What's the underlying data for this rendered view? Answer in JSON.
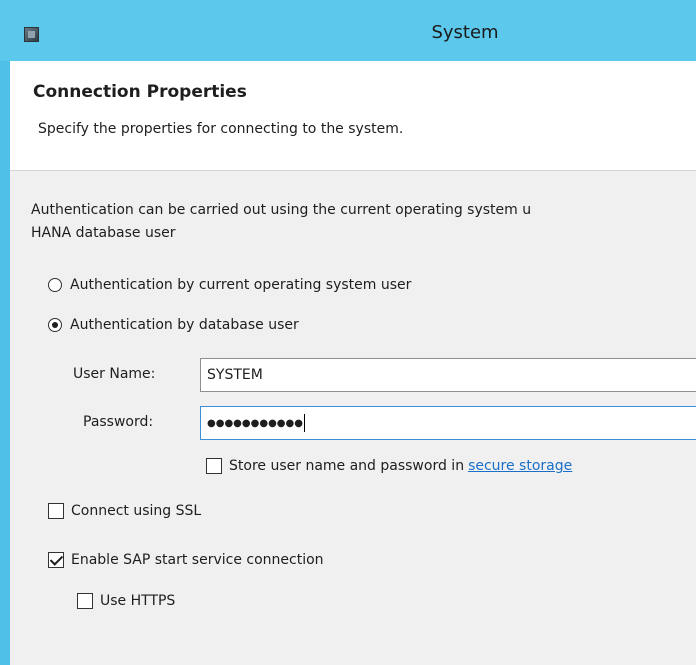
{
  "window": {
    "title": "System"
  },
  "header": {
    "title": "Connection Properties",
    "description": "Specify the properties for connecting to the system."
  },
  "intro_text": "Authentication can be carried out using the current operating system u\nHANA database user",
  "auth": {
    "os_user_label": "Authentication by current operating system user",
    "os_user_selected": false,
    "db_user_label": "Authentication by database user",
    "db_user_selected": true
  },
  "fields": {
    "user_name_label": "User Name:",
    "user_name_value": "SYSTEM",
    "password_label": "Password:",
    "password_value": "●●●●●●●●●●●"
  },
  "store": {
    "label": "Store user name and password in",
    "link": "secure storage",
    "checked": false
  },
  "ssl": {
    "label": "Connect using SSL",
    "checked": false
  },
  "sap_start": {
    "label": "Enable SAP start service connection",
    "checked": true
  },
  "https": {
    "label": "Use HTTPS",
    "checked": false
  },
  "colors": {
    "titlebar": "#5cc8ec",
    "frame": "#4fc1e9",
    "link": "#1a6fc9",
    "panel_bg": "#f0f0f0"
  }
}
